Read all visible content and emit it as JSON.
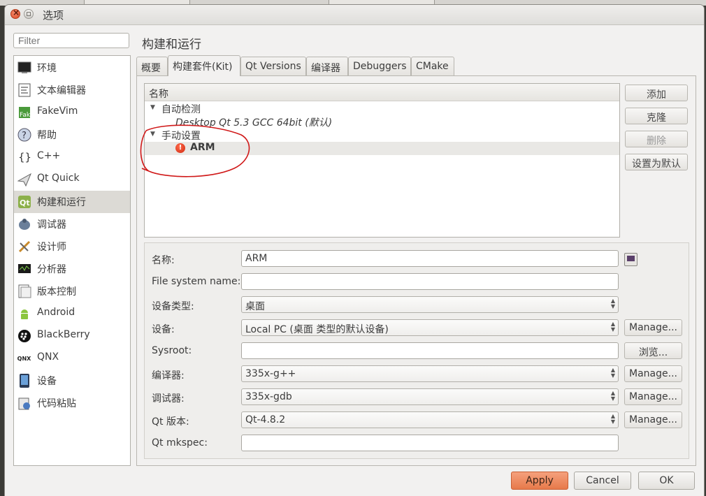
{
  "window": {
    "title": "选项"
  },
  "filter": {
    "placeholder": "Filter"
  },
  "nav": {
    "items": [
      {
        "label": "环境",
        "icon": "monitor-icon"
      },
      {
        "label": "文本编辑器",
        "icon": "text-editor-icon"
      },
      {
        "label": "FakeVim",
        "icon": "fakevim-icon"
      },
      {
        "label": "帮助",
        "icon": "help-icon"
      },
      {
        "label": "C++",
        "icon": "braces-icon"
      },
      {
        "label": "Qt Quick",
        "icon": "paper-plane-icon"
      },
      {
        "label": "构建和运行",
        "icon": "build-run-icon",
        "selected": true
      },
      {
        "label": "调试器",
        "icon": "debugger-icon"
      },
      {
        "label": "设计师",
        "icon": "designer-icon"
      },
      {
        "label": "分析器",
        "icon": "analyzer-icon"
      },
      {
        "label": "版本控制",
        "icon": "version-control-icon"
      },
      {
        "label": "Android",
        "icon": "android-icon"
      },
      {
        "label": "BlackBerry",
        "icon": "blackberry-icon"
      },
      {
        "label": "QNX",
        "icon": "qnx-icon"
      },
      {
        "label": "设备",
        "icon": "device-icon"
      },
      {
        "label": "代码粘贴",
        "icon": "code-paste-icon"
      }
    ]
  },
  "page": {
    "heading": "构建和运行"
  },
  "tabs": [
    "概要",
    "构建套件(Kit)",
    "Qt Versions",
    "编译器",
    "Debuggers",
    "CMake"
  ],
  "kits": {
    "header": "名称",
    "auto_group": "自动检测",
    "auto_item": "Desktop Qt 5.3 GCC 64bit (默认)",
    "manual_group": "手动设置",
    "manual_item": "ARM"
  },
  "side_buttons": {
    "add": "添加",
    "clone": "克隆",
    "remove": "删除",
    "make_default": "设置为默认"
  },
  "form": {
    "name_label": "名称:",
    "name_value": "ARM",
    "fs_label": "File system name:",
    "fs_value": "",
    "devtype_label": "设备类型:",
    "devtype_value": "桌面",
    "device_label": "设备:",
    "device_value": "Local PC (桌面 类型的默认设备)",
    "sysroot_label": "Sysroot:",
    "sysroot_value": "",
    "compiler_label": "编译器:",
    "compiler_value": "335x-g++",
    "debugger_label": "调试器:",
    "debugger_value": "335x-gdb",
    "qtver_label": "Qt 版本:",
    "qtver_value": "Qt-4.8.2",
    "mkspec_label": "Qt mkspec:",
    "mkspec_value": "",
    "manage": "Manage...",
    "browse": "浏览..."
  },
  "bottom": {
    "apply": "Apply",
    "cancel": "Cancel",
    "ok": "OK"
  },
  "colors": {
    "apply_accent": "#e77a4b",
    "annotation_red": "#d01818",
    "selection": "#dcdad5"
  }
}
